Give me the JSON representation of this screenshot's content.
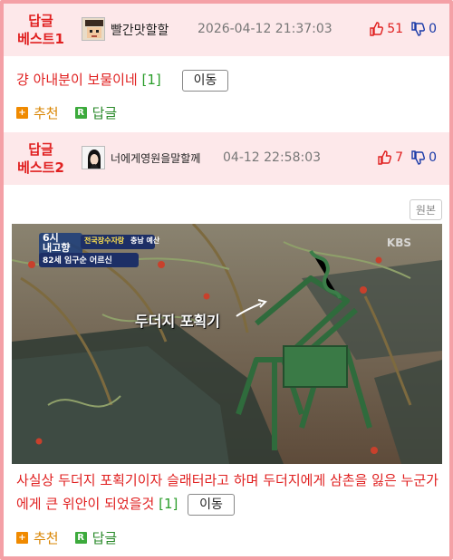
{
  "best1": {
    "label_line1": "답글",
    "label_line2": "베스트1",
    "nickname": "빨간맛할할",
    "date": "2026-04-12 21:37:03",
    "upvotes": "51",
    "downvotes": "0",
    "comment": "걍 아내분이 보물이네",
    "reply_count": "[1]",
    "move_label": "이동",
    "recommend_label": "추천",
    "reply_label": "답글"
  },
  "best2": {
    "label_line1": "답글",
    "label_line2": "베스트2",
    "nickname": "너에게영원을말할께",
    "date": "04-12 22:58:03",
    "upvotes": "7",
    "downvotes": "0",
    "original_label": "원본",
    "image": {
      "caption": "두더지 포획기",
      "badge_line1": "6시",
      "badge_line2": "내고향",
      "show_title": "전국장수자랑",
      "region": "충남 예산",
      "person": "82세 임구순 어르신",
      "watermark": "KBS"
    },
    "comment": "사실상 두더지 포획기이자 슬래터라고 하며 두더지에게 삼촌을 잃은 누군가에게 큰 위안이 되었을것",
    "reply_count": "[1]",
    "move_label": "이동",
    "recommend_label": "추천",
    "reply_label": "답글"
  },
  "colors": {
    "accent_red": "#e02020",
    "header_bg": "#fde8ea",
    "border_pink": "#f4a0a6",
    "reply_green": "#2a9d2a",
    "down_blue": "#1a3aa8",
    "recommend_orange": "#f08a00"
  },
  "icons": {
    "thumb_up": "thumb-up-icon",
    "thumb_down": "thumb-down-icon",
    "recommend": "plus-icon",
    "reply": "reply-r-icon"
  }
}
